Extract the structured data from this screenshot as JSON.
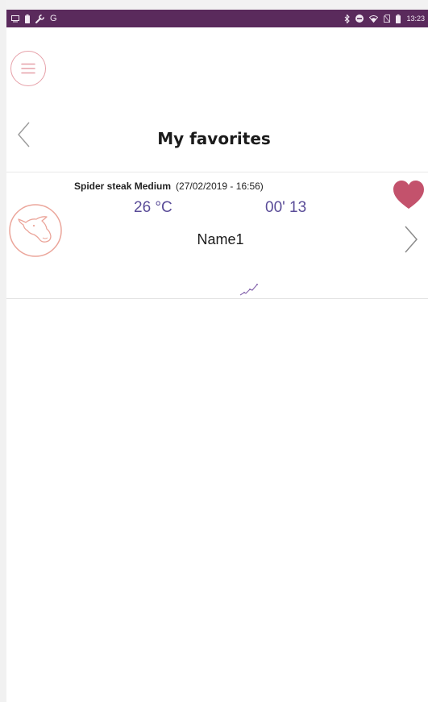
{
  "status_bar": {
    "left_icons": [
      "screen-icon",
      "battery-saver-icon",
      "wrench-icon",
      "google-icon"
    ],
    "right_icons": [
      "bluetooth-icon",
      "do-not-disturb-icon",
      "wifi-icon",
      "no-sim-icon",
      "battery-icon"
    ],
    "google_letter": "G",
    "time": "13:23",
    "background_color": "#5a2a5c"
  },
  "header": {
    "menu_icon": "hamburger-menu-icon",
    "back_icon": "chevron-left-icon",
    "title": "My favorites"
  },
  "favorites": [
    {
      "icon": "cow-head-icon",
      "cut": "Spider steak Medium",
      "date": "(27/02/2019 - 16:56)",
      "temperature": "26 °C",
      "duration": "00' 13",
      "name": "Name1",
      "favorite_icon": "heart-icon",
      "open_icon": "chevron-right-icon",
      "graph_icon": "temperature-curve-icon"
    }
  ],
  "colors": {
    "accent_pink": "#e6a0a8",
    "heart": "#c3526c",
    "value_text": "#5a4c98"
  }
}
